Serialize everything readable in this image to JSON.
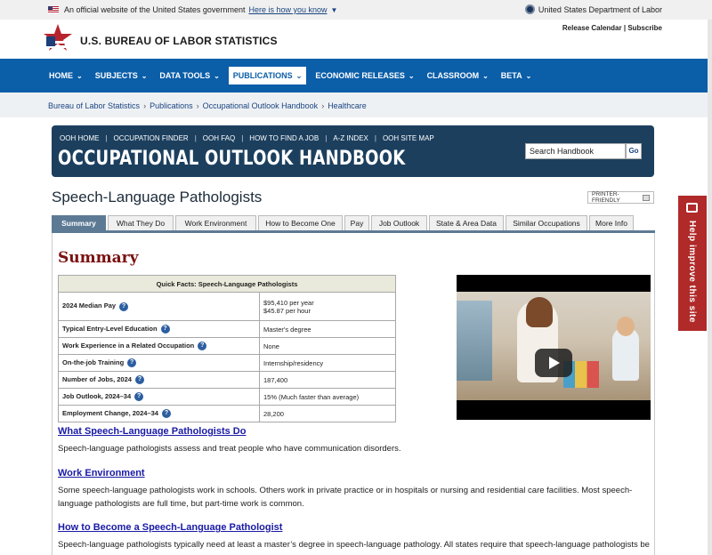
{
  "gov_banner": {
    "text": "An official website of the United States government",
    "link": "Here is how you know",
    "agency": "United States Department of Labor"
  },
  "header": {
    "title": "U.S. BUREAU OF LABOR STATISTICS",
    "links": [
      "Release Calendar",
      "Subscribe"
    ]
  },
  "nav": {
    "items": [
      "HOME",
      "SUBJECTS",
      "DATA TOOLS",
      "PUBLICATIONS",
      "ECONOMIC RELEASES",
      "CLASSROOM",
      "BETA"
    ],
    "active": "PUBLICATIONS"
  },
  "breadcrumb": [
    "Bureau of Labor Statistics",
    "Publications",
    "Occupational Outlook Handbook",
    "Healthcare"
  ],
  "ooh": {
    "links": [
      "OOH HOME",
      "OCCUPATION FINDER",
      "OOH FAQ",
      "HOW TO FIND A JOB",
      "A-Z INDEX",
      "OOH SITE MAP"
    ],
    "title": "OCCUPATIONAL OUTLOOK HANDBOOK",
    "search_value": "Search Handbook",
    "go_label": "Go"
  },
  "page": {
    "title": "Speech-Language Pathologists",
    "printer": "PRINTER-FRIENDLY"
  },
  "tabs": [
    "Summary",
    "What They Do",
    "Work Environment",
    "How to Become One",
    "Pay",
    "Job Outlook",
    "State & Area Data",
    "Similar Occupations",
    "More Info"
  ],
  "summary": {
    "heading": "Summary",
    "table_title": "Quick Facts: Speech-Language Pathologists",
    "rows": [
      {
        "label": "2024 Median Pay",
        "value": "$95,410 per year",
        "value2": "$45.87 per hour"
      },
      {
        "label": "Typical Entry-Level Education",
        "value": "Master's degree"
      },
      {
        "label": "Work Experience in a Related Occupation",
        "value": "None"
      },
      {
        "label": "On-the-job Training",
        "value": "Internship/residency"
      },
      {
        "label": "Number of Jobs, 2024",
        "value": "187,400"
      },
      {
        "label": "Job Outlook, 2024–34",
        "value": "15% (Much faster than average)"
      },
      {
        "label": "Employment Change, 2024–34",
        "value": "28,200"
      }
    ]
  },
  "sections": [
    {
      "link": "What Speech-Language Pathologists Do",
      "text": "Speech-language pathologists assess and treat people who have communication disorders."
    },
    {
      "link": "Work Environment",
      "text": "Some speech-language pathologists work in schools. Others work in private practice or in hospitals or nursing and residential care facilities. Most speech-language pathologists are full time, but part-time work is common."
    },
    {
      "link": "How to Become a Speech-Language Pathologist",
      "text": "Speech-language pathologists typically need at least a master’s degree in speech-language pathology. All states require that speech-language pathologists be"
    }
  ],
  "help": {
    "label": "Help improve this site"
  }
}
